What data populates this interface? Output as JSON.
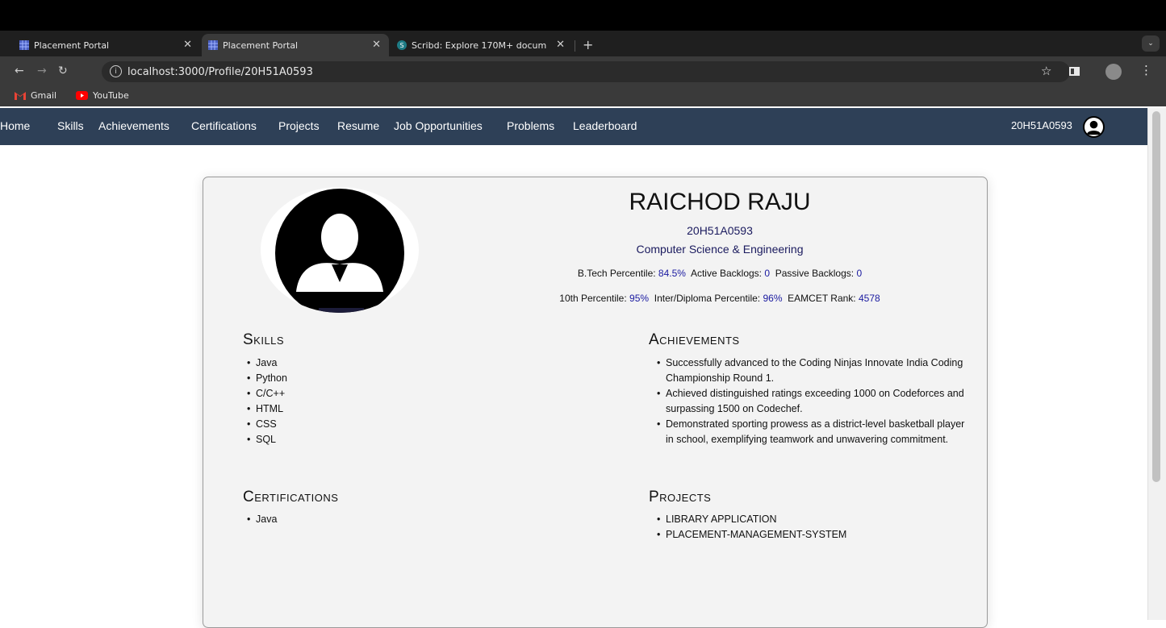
{
  "browser": {
    "tabs": [
      {
        "title": "Placement Portal",
        "active": false
      },
      {
        "title": "Placement Portal",
        "active": true
      },
      {
        "title": "Scribd: Explore 170M+ docum",
        "active": false
      }
    ],
    "url": "localhost:3000/Profile/20H51A0593",
    "bookmarks": [
      "Gmail",
      "YouTube"
    ]
  },
  "sitenav": {
    "links": [
      "Home",
      "Skills",
      "Achievements",
      "Certifications",
      "Projects",
      "Resume",
      "Job Opportunities",
      "Problems",
      "Leaderboard"
    ],
    "user_id": "20H51A0593"
  },
  "profile": {
    "name": "RAICHOD RAJU",
    "roll": "20H51A0593",
    "branch": "Computer Science & Engineering",
    "btech_label": "B.Tech Percentile:",
    "btech_value": "84.5%",
    "active_backlogs_label": "Active Backlogs:",
    "active_backlogs_value": "0",
    "passive_backlogs_label": "Passive Backlogs:",
    "passive_backlogs_value": "0",
    "tenth_label": "10th Percentile:",
    "tenth_value": "95%",
    "inter_label": "Inter/Diploma Percentile:",
    "inter_value": "96%",
    "eamcet_label": "EAMCET Rank:",
    "eamcet_value": "4578"
  },
  "skills": {
    "title": "Skills",
    "items": [
      "Java",
      "Python",
      "C/C++",
      "HTML",
      "CSS",
      "SQL"
    ]
  },
  "achievements": {
    "title": "Achievements",
    "items": [
      "Successfully advanced to the Coding Ninjas Innovate India Coding Championship Round 1.",
      "Achieved distinguished ratings exceeding 1000 on Codeforces and surpassing 1500 on Codechef.",
      "Demonstrated sporting prowess as a district-level basketball player in school, exemplifying teamwork and unwavering commitment."
    ]
  },
  "certifications": {
    "title": "Certifications",
    "items": [
      "Java"
    ]
  },
  "projects": {
    "title": "Projects",
    "items": [
      "LIBRARY APPLICATION",
      "PLACEMENT-MANAGEMENT-SYSTEM"
    ]
  },
  "colors": {
    "nav_bg": "#2e4057",
    "accent_text": "#1a1a5e",
    "value_text": "#1a1aa0"
  }
}
